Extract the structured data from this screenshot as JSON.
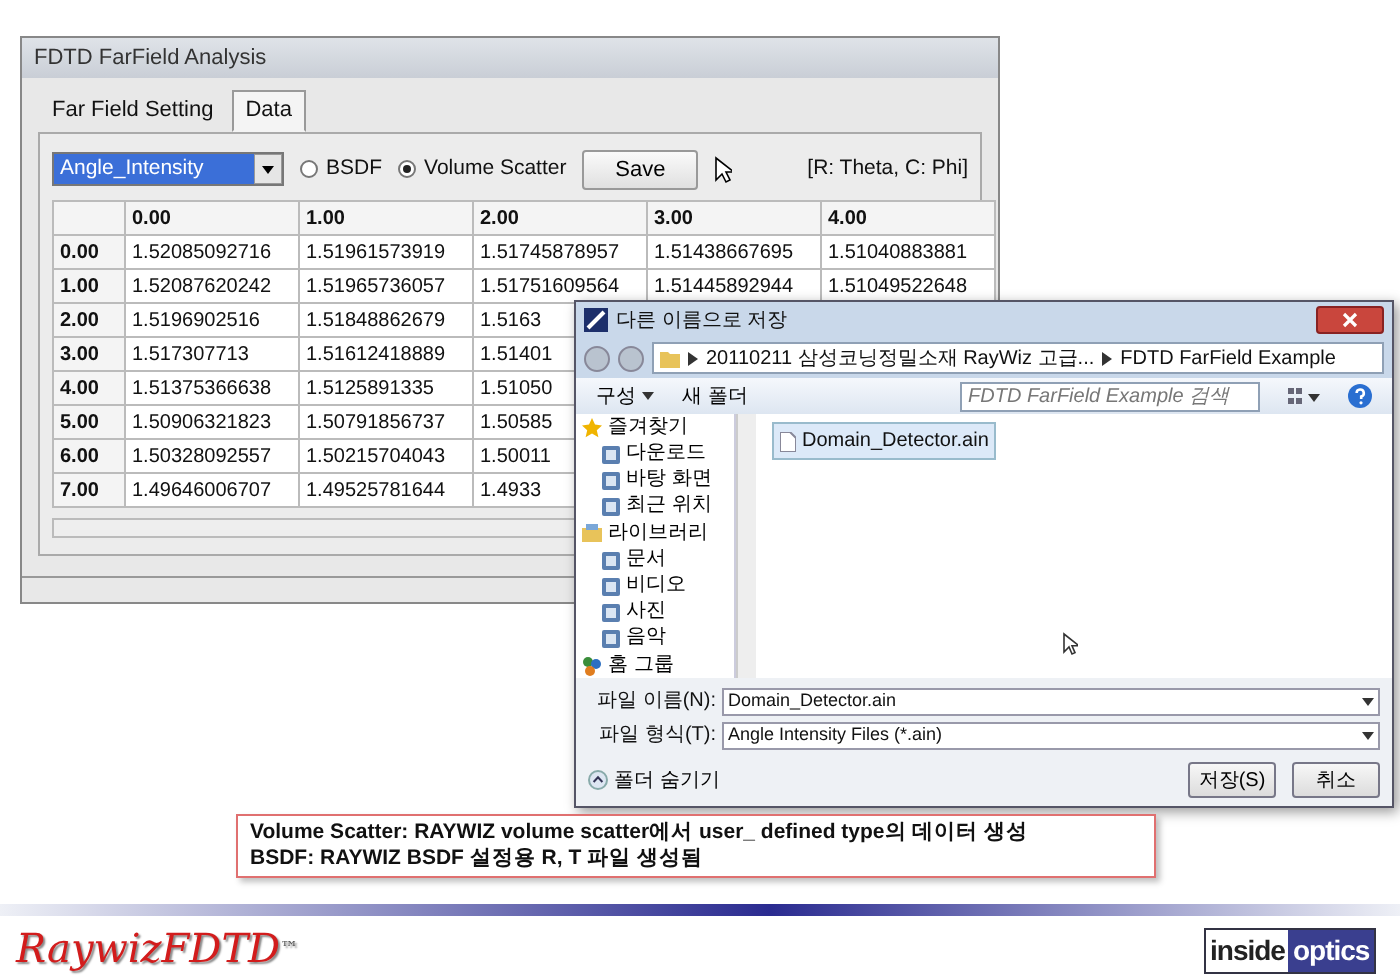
{
  "main_window": {
    "title": "FDTD FarField Analysis",
    "tabs": [
      {
        "label": "Far Field Setting",
        "selected": false
      },
      {
        "label": "Data",
        "selected": true
      }
    ],
    "dropdown": {
      "value": "Angle_Intensity"
    },
    "radios": [
      {
        "label": "BSDF",
        "selected": false
      },
      {
        "label": "Volume Scatter",
        "selected": true
      }
    ],
    "save_button": "Save",
    "axis_note": "[R: Theta, C: Phi]",
    "table": {
      "columns": [
        "0.00",
        "1.00",
        "2.00",
        "3.00",
        "4.00"
      ],
      "rows": [
        {
          "header": "0.00",
          "cells": [
            "1.52085092716",
            "1.51961573919",
            "1.51745878957",
            "1.51438667695",
            "1.51040883881"
          ]
        },
        {
          "header": "1.00",
          "cells": [
            "1.52087620242",
            "1.51965736057",
            "1.51751609564",
            "1.51445892944",
            "1.51049522648"
          ]
        },
        {
          "header": "2.00",
          "cells": [
            "1.5196902516",
            "1.51848862679",
            "1.5163"
          ]
        },
        {
          "header": "3.00",
          "cells": [
            "1.517307713",
            "1.51612418889",
            "1.51401"
          ]
        },
        {
          "header": "4.00",
          "cells": [
            "1.51375366638",
            "1.5125891335",
            "1.51050"
          ]
        },
        {
          "header": "5.00",
          "cells": [
            "1.50906321823",
            "1.50791856737",
            "1.50585"
          ]
        },
        {
          "header": "6.00",
          "cells": [
            "1.50328092557",
            "1.50215704043",
            "1.50011"
          ]
        },
        {
          "header": "7.00",
          "cells": [
            "1.49646006707",
            "1.49525781644",
            "1.4933"
          ]
        }
      ]
    }
  },
  "save_dialog": {
    "title": "다른 이름으로 저장",
    "breadcrumb": [
      "20110211 삼성코닝정밀소재 RayWiz 고급...",
      "FDTD FarField Example"
    ],
    "search": {
      "placeholder": "FDTD FarField Example 검색"
    },
    "toolbar": [
      {
        "label": "구성",
        "dropdown": true
      },
      {
        "label": "새 폴더",
        "dropdown": false
      }
    ],
    "nav": [
      {
        "label": "즐겨찾기",
        "children": [
          {
            "label": "다운로드"
          },
          {
            "label": "바탕 화면"
          },
          {
            "label": "최근 위치"
          }
        ]
      },
      {
        "label": "라이브러리",
        "children": [
          {
            "label": "문서"
          },
          {
            "label": "비디오"
          },
          {
            "label": "사진"
          },
          {
            "label": "음악"
          }
        ]
      },
      {
        "label": "홈 그룹"
      }
    ],
    "files": [
      {
        "name": "Domain_Detector.ain",
        "selected": true
      }
    ],
    "file_name": {
      "label": "파일 이름(N):",
      "value": "Domain_Detector.ain"
    },
    "file_type": {
      "label": "파일 형식(T):",
      "value": "Angle Intensity Files (*.ain)"
    },
    "hide_folders": "폴더 숨기기",
    "buttons": [
      "저장(S)",
      "취소"
    ]
  },
  "caption": {
    "lines": [
      "Volume Scatter: RAYWIZ volume scatter에서 user_ defined type의 데이터 생성",
      "BSDF: RAYWIZ BSDF 설정용 R, T 파일 생성됨"
    ]
  },
  "footer": {
    "brand": "RaywizFDTD",
    "trademark": "™",
    "logo": [
      "inside",
      "optics"
    ]
  }
}
